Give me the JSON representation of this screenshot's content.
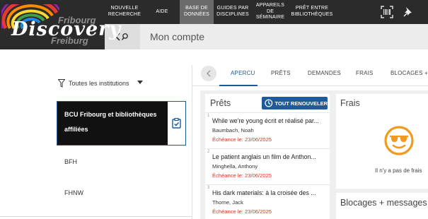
{
  "brand": {
    "line1": "Fribourg",
    "script": "Discovery",
    "line2": "Freiburg"
  },
  "nav": [
    {
      "id": "nouvelle-recherche",
      "label": "NOUVELLE\nRECHERCHE"
    },
    {
      "id": "aide",
      "label": "AIDE"
    },
    {
      "id": "base-de-donnees",
      "label": "BASE DE\nDONNÉES"
    },
    {
      "id": "guides-par-disciplines",
      "label": "GUIDES PAR\nDISCIPLINES"
    },
    {
      "id": "appareils-de-seminaire",
      "label": "APPAREILS\nDE\nSÉMINAIRE"
    },
    {
      "id": "pret-entre-bibliotheques",
      "label": "PRÊT ENTRE\nBIBLIOTHÈQUES"
    }
  ],
  "top_icons": [
    "barcode-scan-icon",
    "pin-icon"
  ],
  "page": {
    "title": "Mon compte",
    "back_icon": "back-search-icon"
  },
  "filter": {
    "label": "Toutes les institutions",
    "icon": "filter-icon",
    "dropdown_icon": "caret-down-icon"
  },
  "institutions": {
    "active": {
      "label": "BCU Fribourg et bibliothèques affiliées",
      "icon": "clipboard-check-icon"
    },
    "others": [
      "BFH",
      "FHNW"
    ]
  },
  "tabs": [
    "APERCU",
    "PRÊTS",
    "DEMANDES",
    "FRAIS",
    "BLOCAGES + ME"
  ],
  "active_tab": "APERCU",
  "loans": {
    "title": "Prêts",
    "renew_all": "TOUT RENOUVELER",
    "items": [
      {
        "num": "1",
        "title": "While we're young écrit et réalisé par...",
        "author": "Baumbach, Noah",
        "due": "Échéance le: 23/06/2025"
      },
      {
        "num": "2",
        "title": "Le patient anglais un film de Anthon...",
        "author": "Minghella, Anthony",
        "due": "Échéance le: 23/06/2025"
      },
      {
        "num": "3",
        "title": "His dark materials: à la croisée des ...",
        "author": "Thorne, Jack",
        "due": "Échéance le: 23/06/2025"
      }
    ]
  },
  "fees": {
    "title": "Frais",
    "empty_text": "Il n'y a pas de frais",
    "icon": "sunglasses-smiley-icon"
  },
  "blocks": {
    "title": "Blocages + messages"
  },
  "colors": {
    "accent": "#1f5a9c",
    "due": "#d03a2a",
    "topbar": "#2b2b2b",
    "smiley": "#f19a1f"
  }
}
